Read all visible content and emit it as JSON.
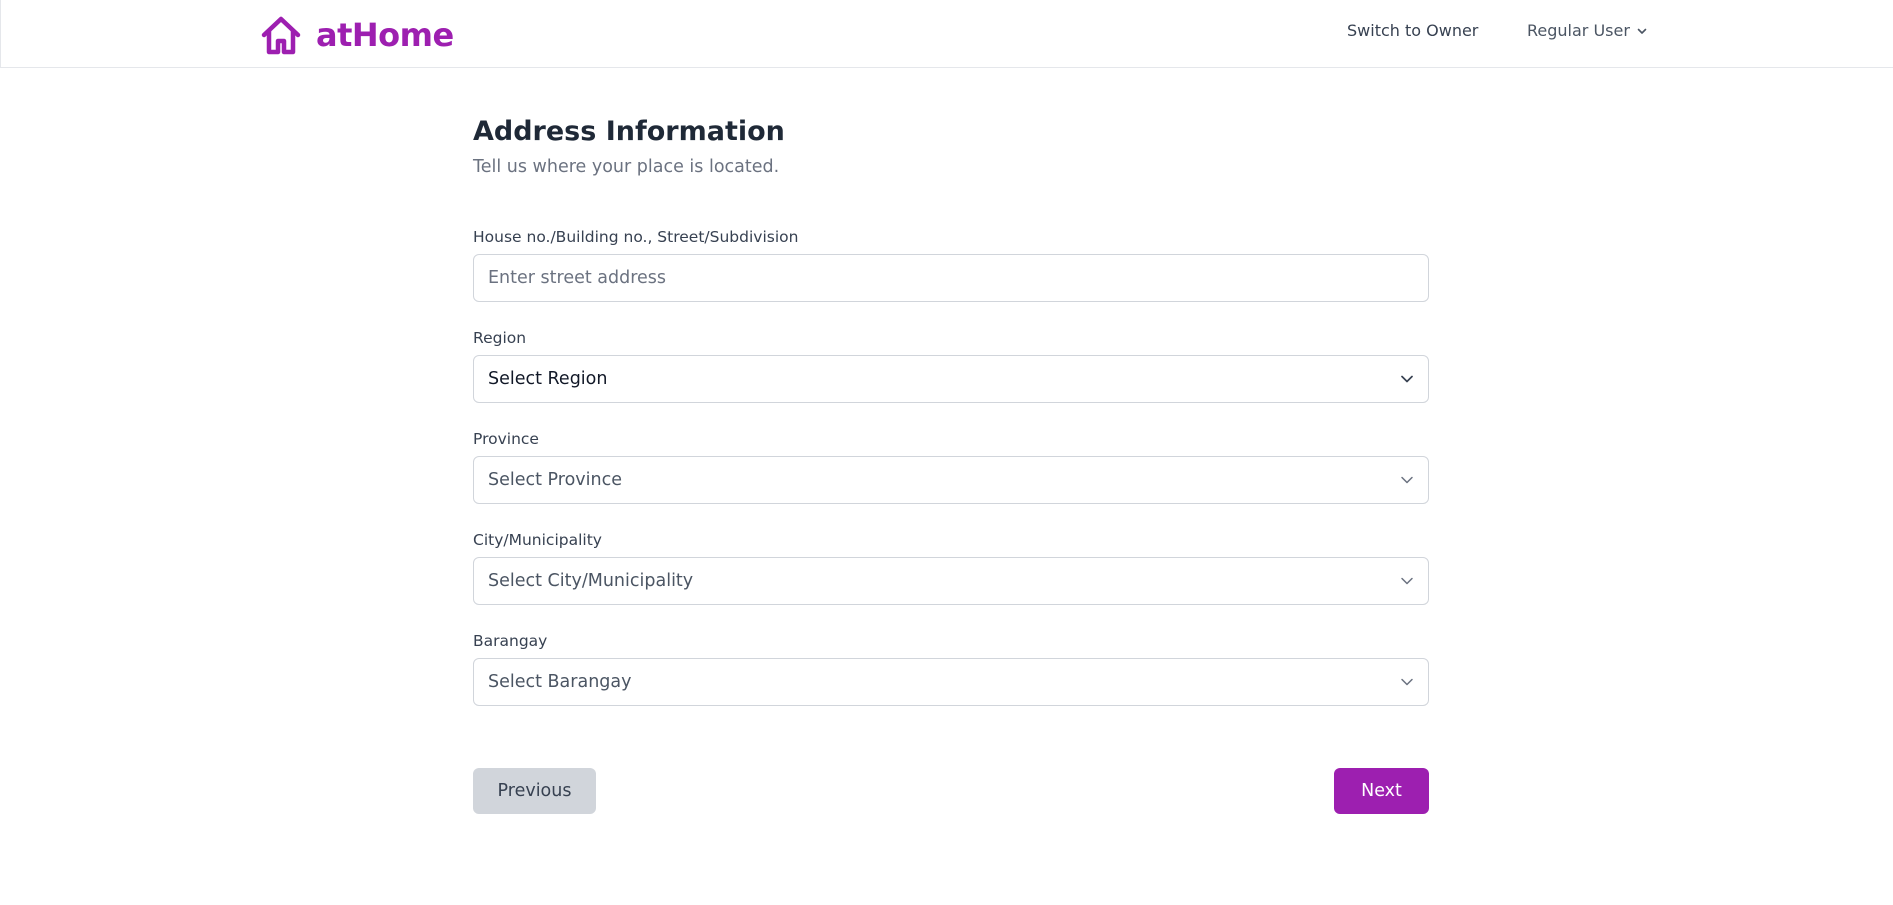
{
  "header": {
    "logo_text": "atHome",
    "switch_label": "Switch to Owner",
    "user_label": "Regular User"
  },
  "page": {
    "title": "Address Information",
    "subtitle": "Tell us where your place is located."
  },
  "form": {
    "street": {
      "label": "House no./Building no., Street/Subdivision",
      "value": "",
      "placeholder": "Enter street address"
    },
    "region": {
      "label": "Region",
      "selected": "Select Region"
    },
    "province": {
      "label": "Province",
      "selected": "Select Province"
    },
    "city": {
      "label": "City/Municipality",
      "selected": "Select City/Municipality"
    },
    "barangay": {
      "label": "Barangay",
      "selected": "Select Barangay"
    }
  },
  "actions": {
    "previous_label": "Previous",
    "next_label": "Next"
  },
  "colors": {
    "brand": "#9d1fb0",
    "secondary_button": "#d1d5db"
  },
  "icons": {
    "logo": "house-icon",
    "dropdown": "chevron-down-icon"
  }
}
